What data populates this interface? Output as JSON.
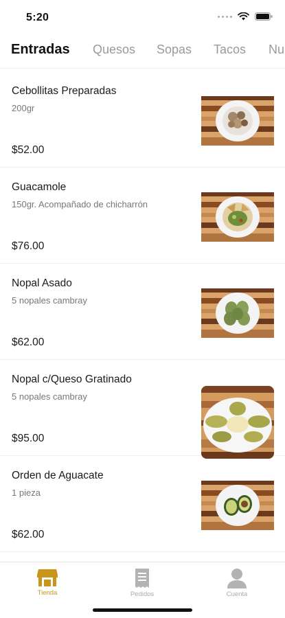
{
  "status_bar": {
    "time": "5:20"
  },
  "tabs": [
    {
      "label": "Entradas",
      "active": true
    },
    {
      "label": "Quesos",
      "active": false
    },
    {
      "label": "Sopas",
      "active": false
    },
    {
      "label": "Tacos",
      "active": false
    },
    {
      "label": "Nu",
      "active": false
    }
  ],
  "products": [
    {
      "name": "Cebollitas Preparadas",
      "description": "200gr",
      "price": "$52.00",
      "image_icon": "cebollitas-dish"
    },
    {
      "name": "Guacamole",
      "description": "150gr. Acompañado de chicharrón",
      "price": "$76.00",
      "image_icon": "guacamole-dish"
    },
    {
      "name": "Nopal Asado",
      "description": "5 nopales cambray",
      "price": "$62.00",
      "image_icon": "nopal-dish"
    },
    {
      "name": "Nopal c/Queso Gratinado",
      "description": "5 nopales cambray",
      "price": "$95.00",
      "image_icon": "nopal-queso-dish"
    },
    {
      "name": "Orden de Aguacate",
      "description": "1 pieza",
      "price": "$62.00",
      "image_icon": "aguacate-dish"
    }
  ],
  "bottom_nav": [
    {
      "label": "Tienda",
      "icon": "store-icon",
      "active": true
    },
    {
      "label": "Pedidos",
      "icon": "receipt-icon",
      "active": false
    },
    {
      "label": "Cuenta",
      "icon": "person-icon",
      "active": false
    }
  ],
  "colors": {
    "accent": "#c9941a",
    "inactive": "#aaaaaa",
    "wood_dark": "#6b3a1c",
    "wood_light": "#d9a36a"
  }
}
